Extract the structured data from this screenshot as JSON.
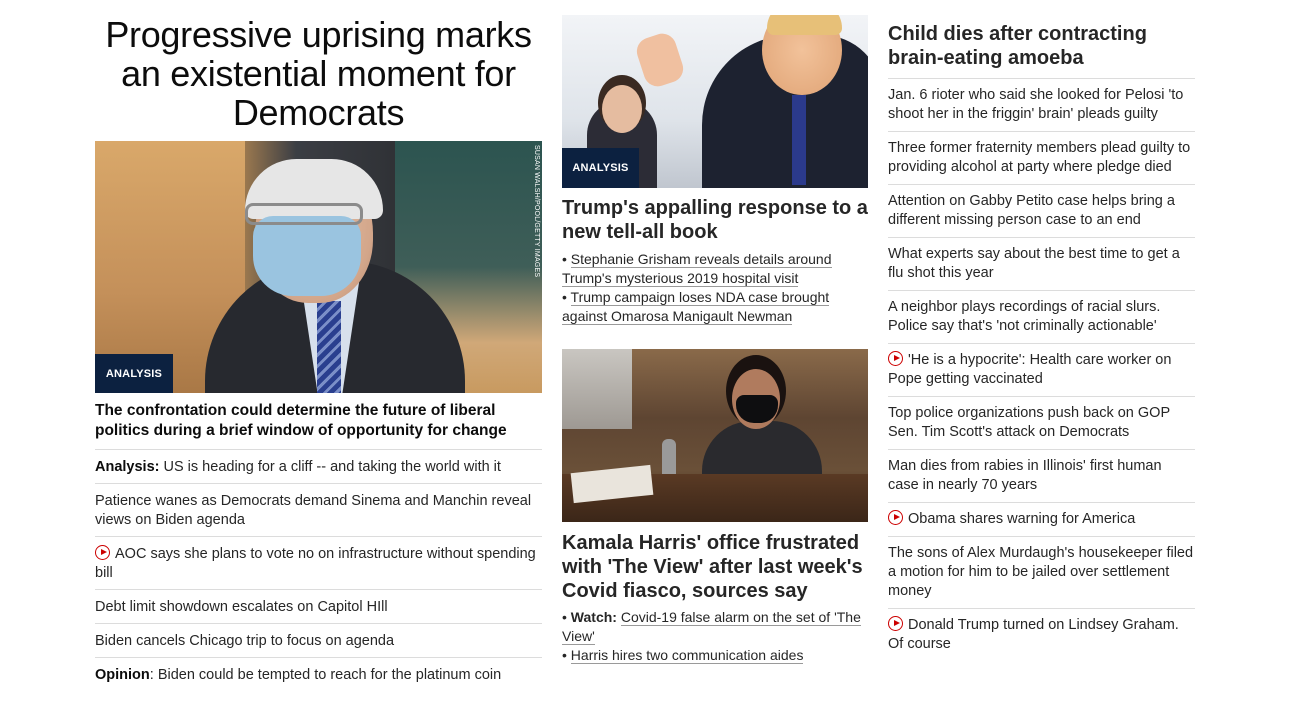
{
  "left": {
    "hero_title": "Progressive uprising marks an existential moment for Democrats",
    "hero_tag": "ANALYSIS",
    "photo_credit": "SUSAN WALSH/POOL/GETTY IMAGES",
    "hero_caption": "The confrontation could determine the future of liberal politics during a brief window of opportunity for change",
    "items": [
      {
        "prefix": "Analysis:",
        "text": " US is heading for a cliff -- and taking the world with it"
      },
      {
        "text": "Patience wanes as Democrats demand Sinema and Manchin reveal views on Biden agenda"
      },
      {
        "video": true,
        "text": "AOC says she plans to vote no on infrastructure without spending bill"
      },
      {
        "text": "Debt limit showdown escalates on Capitol HIll"
      },
      {
        "text": "Biden cancels Chicago trip to focus on agenda"
      },
      {
        "prefix": "Opinion",
        "text": ": Biden could be tempted to reach for the platinum coin"
      }
    ]
  },
  "middle": {
    "story1": {
      "tag": "ANALYSIS",
      "headline": "Trump's appalling response to a new tell-all book",
      "bullets": [
        {
          "text": "Stephanie Grisham reveals details around Trump's mysterious 2019 hospital visit"
        },
        {
          "text": "Trump campaign loses NDA case brought against Omarosa Manigault Newman"
        }
      ]
    },
    "story2": {
      "headline": "Kamala Harris' office frustrated with 'The View' after last week's Covid fiasco, sources say",
      "bullets": [
        {
          "prefix": "Watch:",
          "text": "Covid-19 false alarm on the set of 'The View'"
        },
        {
          "text": "Harris hires two communication aides"
        }
      ]
    }
  },
  "right": {
    "headline": "Child dies after contracting brain-eating amoeba",
    "items": [
      {
        "text": "Jan. 6 rioter who said she looked for Pelosi 'to shoot her in the friggin' brain' pleads guilty"
      },
      {
        "text": "Three former fraternity members plead guilty to providing alcohol at party where pledge died"
      },
      {
        "text": "Attention on Gabby Petito case helps bring a different missing person case to an end"
      },
      {
        "text": "What experts say about the best time to get a flu shot this year"
      },
      {
        "text": "A neighbor plays recordings of racial slurs. Police say that's 'not criminally actionable'"
      },
      {
        "video": true,
        "text": "'He is a hypocrite': Health care worker on Pope getting vaccinated"
      },
      {
        "text": "Top police organizations push back on GOP Sen. Tim Scott's attack on Democrats"
      },
      {
        "text": "Man dies from rabies in Illinois' first human case in nearly 70 years"
      },
      {
        "video": true,
        "text": "Obama shares warning for America"
      },
      {
        "text": "The sons of Alex Murdaugh's housekeeper filed a motion for him to be jailed over settlement money"
      },
      {
        "video": true,
        "text": "Donald Trump turned on Lindsey Graham. Of course"
      }
    ]
  },
  "colors": {
    "tag_bg": "#0c2140",
    "video_icon": "#cc0000",
    "divider": "#dcdcdc"
  },
  "icons": {
    "video": "play-circle-icon"
  }
}
